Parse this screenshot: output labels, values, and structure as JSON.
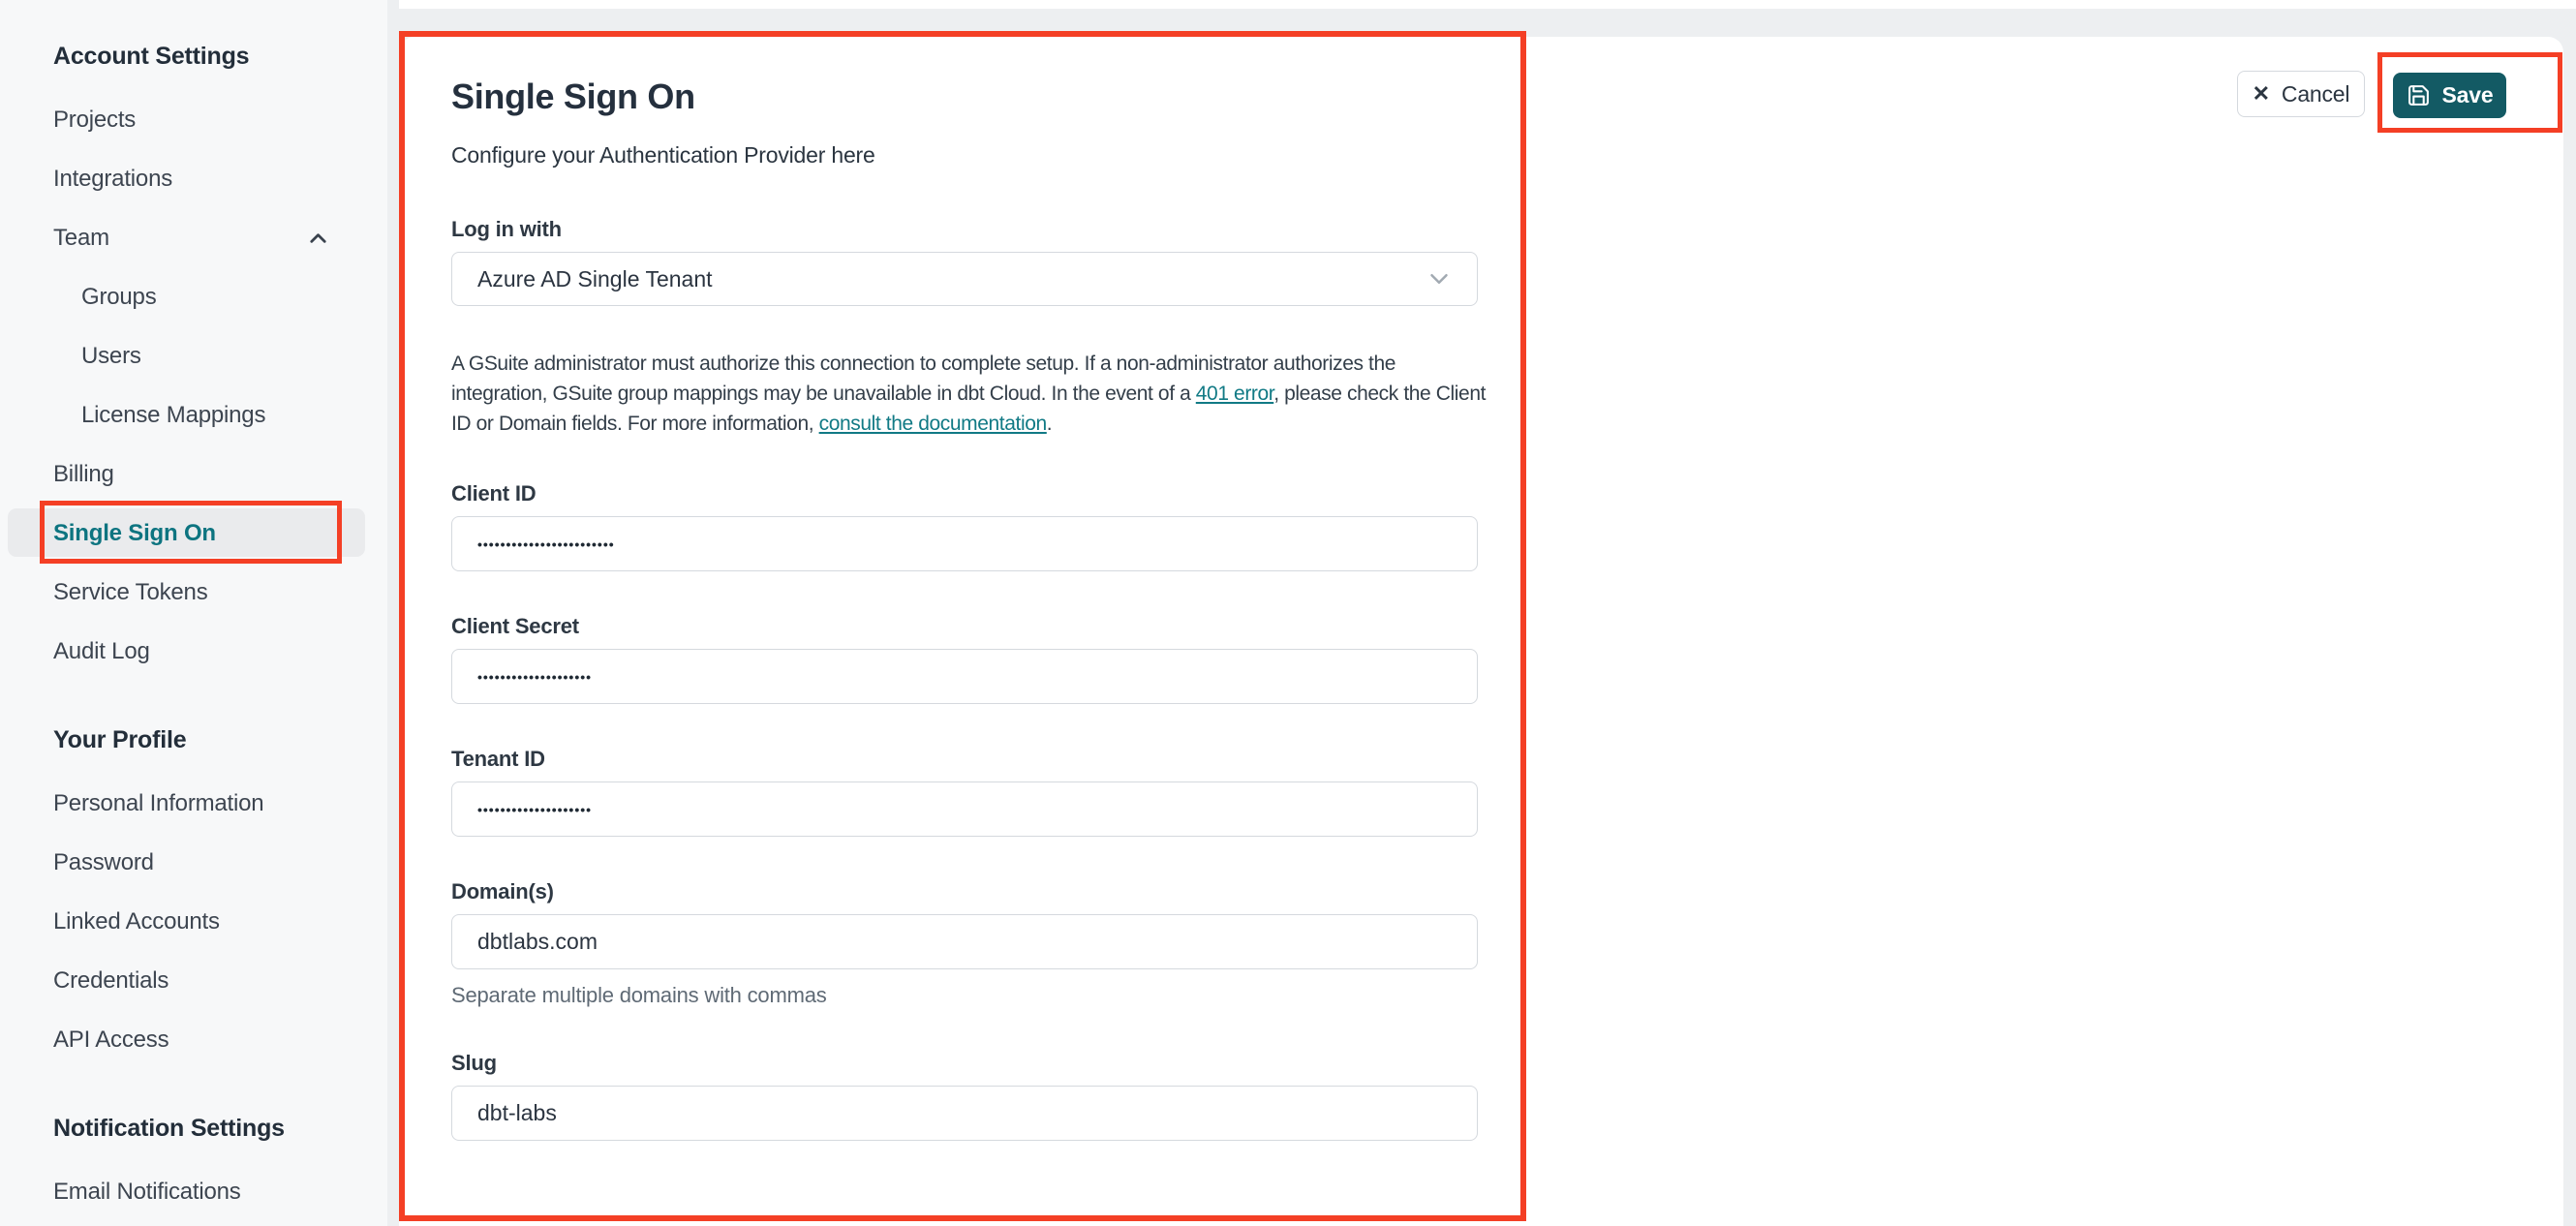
{
  "sidebar": {
    "sections": [
      {
        "heading": "Account Settings",
        "items": [
          {
            "label": "Projects"
          },
          {
            "label": "Integrations"
          },
          {
            "label": "Team"
          },
          {
            "label": "Groups"
          },
          {
            "label": "Users"
          },
          {
            "label": "License Mappings"
          },
          {
            "label": "Billing"
          },
          {
            "label": "Single Sign On"
          },
          {
            "label": "Service Tokens"
          },
          {
            "label": "Audit Log"
          }
        ]
      },
      {
        "heading": "Your Profile",
        "items": [
          {
            "label": "Personal Information"
          },
          {
            "label": "Password"
          },
          {
            "label": "Linked Accounts"
          },
          {
            "label": "Credentials"
          },
          {
            "label": "API Access"
          }
        ]
      },
      {
        "heading": "Notification Settings",
        "items": [
          {
            "label": "Email Notifications"
          }
        ]
      }
    ]
  },
  "header": {
    "cancel_label": "Cancel",
    "save_label": "Save"
  },
  "main": {
    "title": "Single Sign On",
    "subtitle": "Configure your Authentication Provider here",
    "login_with": {
      "label": "Log in with",
      "value": "Azure AD Single Tenant"
    },
    "note": {
      "line1": "A GSuite administrator must authorize this connection to complete setup. If a non-administrator authorizes the",
      "line2_pre": "integration, GSuite group mappings may be unavailable in dbt Cloud. In the event of a ",
      "line2_link": "401 error",
      "line2_post": ", please check the Client",
      "line3_pre": "ID or Domain fields. For more information, ",
      "line3_link": "consult the documentation",
      "line3_post": "."
    },
    "client_id": {
      "label": "Client ID",
      "value": "••••••••••••••••••••••••"
    },
    "client_secret": {
      "label": "Client Secret",
      "value": "••••••••••••••••••••"
    },
    "tenant_id": {
      "label": "Tenant ID",
      "value": "••••••••••••••••••••"
    },
    "domains": {
      "label": "Domain(s)",
      "value": "dbtlabs.com",
      "helper": "Separate multiple domains with commas"
    },
    "slug": {
      "label": "Slug",
      "value": "dbt-labs"
    }
  },
  "colors": {
    "annotation_red": "#f43f25",
    "save_button_teal": "#135a64",
    "link_teal": "#117a85",
    "active_item_teal": "#0d7480"
  }
}
